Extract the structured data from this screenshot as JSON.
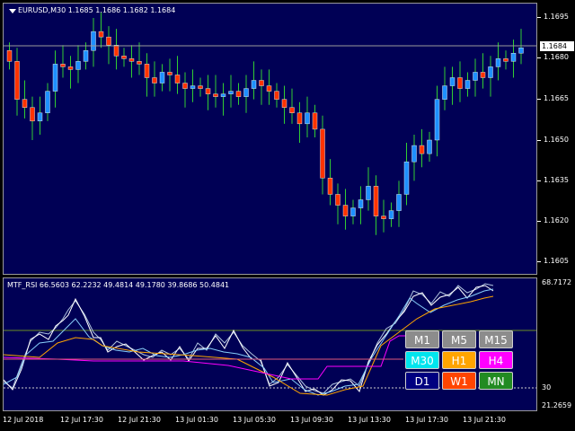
{
  "main_chart": {
    "title": "EURUSD,M30  1.1685 1.1686 1.1682 1.1684",
    "current_price": "1.1684",
    "price_axis": [
      "1.1695",
      "1.1680",
      "1.1665",
      "1.1650",
      "1.1635",
      "1.1620",
      "1.1605"
    ],
    "colors": {
      "bull": "#1e90ff",
      "bear": "#ff3300",
      "wick": "#32cd32",
      "background": "#000055",
      "price_line": "#9a9a9a"
    }
  },
  "indicator": {
    "title": "MTF_RSI 66.5603 62.2232 49.4814 49.1780 39.8686 50.4841",
    "axis_labels": [
      "68.7172",
      "30",
      "21.2659"
    ],
    "series_colors": {
      "m1": "#ffffff",
      "m5": "#b0c4de",
      "m15": "#87cefa",
      "m30": "#00e5ee",
      "h1": "#ffa500",
      "h4": "#ff00ff",
      "d1": "#e05a7a",
      "w1": "#ff4500",
      "mn": "#2e8b57"
    }
  },
  "time_axis": [
    "12 Jul 2018",
    "12 Jul 17:30",
    "12 Jul 21:30",
    "13 Jul 01:30",
    "13 Jul 05:30",
    "13 Jul 09:30",
    "13 Jul 13:30",
    "13 Jul 17:30",
    "13 Jul 21:30"
  ],
  "timeframe_buttons": [
    {
      "label": "M1",
      "bg": "#8c8c8c",
      "fg": "#ffffff"
    },
    {
      "label": "M5",
      "bg": "#8c8c8c",
      "fg": "#ffffff"
    },
    {
      "label": "M15",
      "bg": "#8c8c8c",
      "fg": "#ffffff"
    },
    {
      "label": "M30",
      "bg": "#00e5ee",
      "fg": "#ffffff"
    },
    {
      "label": "H1",
      "bg": "#ffa500",
      "fg": "#ffffff"
    },
    {
      "label": "H4",
      "bg": "#ff00ff",
      "fg": "#ffffff"
    },
    {
      "label": "D1",
      "bg": "#000080",
      "fg": "#ffffff"
    },
    {
      "label": "W1",
      "bg": "#ff4500",
      "fg": "#ffffff"
    },
    {
      "label": "MN",
      "bg": "#228b22",
      "fg": "#ffffff"
    }
  ],
  "chart_data": {
    "type": "candlestick",
    "symbol": "EURUSD",
    "timeframe": "M30",
    "ylim": [
      1.16,
      1.17
    ],
    "ohlc_approx_close": [
      1.1679,
      1.1665,
      1.1662,
      1.1657,
      1.166,
      1.1668,
      1.1678,
      1.1677,
      1.1676,
      1.1679,
      1.1683,
      1.169,
      1.1688,
      1.1685,
      1.1681,
      1.168,
      1.1679,
      1.1678,
      1.1673,
      1.1671,
      1.1675,
      1.1674,
      1.1671,
      1.1669,
      1.167,
      1.1669,
      1.1667,
      1.1666,
      1.1667,
      1.1668,
      1.1666,
      1.1669,
      1.1672,
      1.167,
      1.1668,
      1.1665,
      1.1662,
      1.166,
      1.1656,
      1.166,
      1.1654,
      1.1636,
      1.163,
      1.1626,
      1.1622,
      1.1625,
      1.1628,
      1.1633,
      1.1622,
      1.1621,
      1.1624,
      1.163,
      1.1642,
      1.1648,
      1.1645,
      1.165,
      1.1665,
      1.167,
      1.1673,
      1.1669,
      1.1672,
      1.1675,
      1.1673,
      1.1677,
      1.168,
      1.1679,
      1.1682,
      1.1684
    ]
  }
}
